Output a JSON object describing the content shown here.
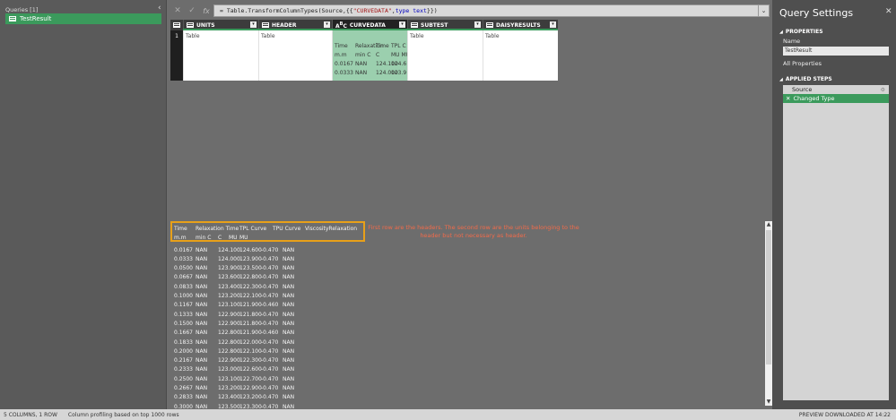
{
  "queries": {
    "header": "Queries [1]",
    "items": [
      {
        "label": "TestResult"
      }
    ]
  },
  "formula": {
    "prefix": "= Table.TransformColumnTypes(Source,{{",
    "string": "\"CURVEDATA\"",
    "sep": ", ",
    "type_kw": "type text",
    "suffix": "}})"
  },
  "grid": {
    "columns": [
      {
        "name": "UNITS"
      },
      {
        "name": "HEADER"
      },
      {
        "name": "CURVEDATA"
      },
      {
        "name": "SUBTEST"
      },
      {
        "name": "DAISYRESULTS"
      }
    ],
    "row_number": "1",
    "cells": [
      "Table",
      "Table",
      "",
      "Table",
      "Table"
    ],
    "curve_nested": [
      [
        "Time",
        "Relaxation",
        "Time",
        "TPL C"
      ],
      [
        "m.m",
        "min C",
        "C",
        "MU  MU"
      ],
      [
        "0.0167",
        "NAN",
        "124.100",
        "124.6"
      ],
      [
        "0.0333",
        "NAN",
        "124.000",
        "123.9"
      ]
    ]
  },
  "preview": {
    "header_row": [
      "Time",
      "Relaxation Time",
      "TPL Curve",
      "TPU Curve",
      "ViscosityRelaxation"
    ],
    "units_row": [
      "m.m",
      "min C",
      "C",
      "MU",
      "MU"
    ],
    "rows": [
      [
        "0.0167",
        "NAN",
        "124.100",
        "124.600",
        "-0.470",
        "NAN"
      ],
      [
        "0.0333",
        "NAN",
        "124.000",
        "123.900",
        "-0.470",
        "NAN"
      ],
      [
        "0.0500",
        "NAN",
        "123.900",
        "123.500",
        "-0.470",
        "NAN"
      ],
      [
        "0.0667",
        "NAN",
        "123.600",
        "122.800",
        "-0.470",
        "NAN"
      ],
      [
        "0.0833",
        "NAN",
        "123.400",
        "122.300",
        "-0.470",
        "NAN"
      ],
      [
        "0.1000",
        "NAN",
        "123.200",
        "122.100",
        "-0.470",
        "NAN"
      ],
      [
        "0.1167",
        "NAN",
        "123.100",
        "121.900",
        "-0.460",
        "NAN"
      ],
      [
        "0.1333",
        "NAN",
        "122.900",
        "121.800",
        "-0.470",
        "NAN"
      ],
      [
        "0.1500",
        "NAN",
        "122.900",
        "121.800",
        "-0.470",
        "NAN"
      ],
      [
        "0.1667",
        "NAN",
        "122.800",
        "121.900",
        "-0.460",
        "NAN"
      ],
      [
        "0.1833",
        "NAN",
        "122.800",
        "122.000",
        "-0.470",
        "NAN"
      ],
      [
        "0.2000",
        "NAN",
        "122.800",
        "122.100",
        "-0.470",
        "NAN"
      ],
      [
        "0.2167",
        "NAN",
        "122.900",
        "122.300",
        "-0.470",
        "NAN"
      ],
      [
        "0.2333",
        "NAN",
        "123.000",
        "122.600",
        "-0.470",
        "NAN"
      ],
      [
        "0.2500",
        "NAN",
        "123.100",
        "122.700",
        "-0.470",
        "NAN"
      ],
      [
        "0.2667",
        "NAN",
        "123.200",
        "122.900",
        "-0.470",
        "NAN"
      ],
      [
        "0.2833",
        "NAN",
        "123.400",
        "123.200",
        "-0.470",
        "NAN"
      ],
      [
        "0.3000",
        "NAN",
        "123.500",
        "123.300",
        "-0.470",
        "NAN"
      ]
    ],
    "annotation_line1": "First row are the headers. The second row are the units belonging to the",
    "annotation_line2": "header but not necessary as header."
  },
  "settings": {
    "title": "Query Settings",
    "properties_label": "PROPERTIES",
    "name_label": "Name",
    "name_value": "TestResult",
    "all_properties": "All Properties",
    "applied_steps_label": "APPLIED STEPS",
    "steps": [
      {
        "label": "Source"
      },
      {
        "label": "Changed Type"
      }
    ]
  },
  "status": {
    "columns": "5 COLUMNS, 1 ROW",
    "profiling": "Column profiling based on top 1000 rows",
    "downloaded": "PREVIEW DOWNLOADED AT 14:22"
  },
  "colors": {
    "accent": "#3b9a5c",
    "highlight": "#e8a019",
    "annotation": "#f26b4a"
  }
}
